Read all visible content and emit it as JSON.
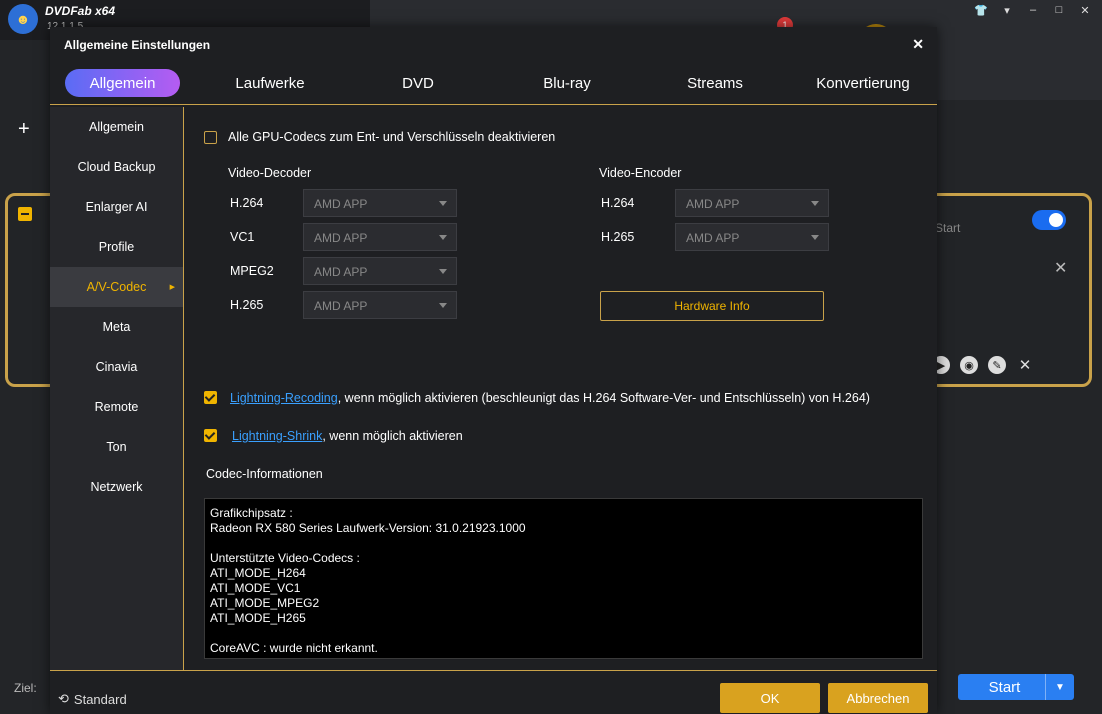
{
  "app": {
    "name": "DVDFab x64",
    "version": "12.1.1.5",
    "notification_count": "1",
    "task_toggle_label": "Start",
    "target_label": "Ziel:",
    "start_button": "Start"
  },
  "dialog": {
    "title": "Allgemeine Einstellungen",
    "tabs": [
      {
        "label": "Allgemein",
        "active": true
      },
      {
        "label": "Laufwerke"
      },
      {
        "label": "DVD"
      },
      {
        "label": "Blu-ray"
      },
      {
        "label": "Streams"
      },
      {
        "label": "Konvertierung"
      }
    ],
    "sidebar": [
      {
        "label": "Allgemein"
      },
      {
        "label": "Cloud Backup"
      },
      {
        "label": "Enlarger AI"
      },
      {
        "label": "Profile"
      },
      {
        "label": "A/V-Codec",
        "active": true
      },
      {
        "label": "Meta"
      },
      {
        "label": "Cinavia"
      },
      {
        "label": "Remote"
      },
      {
        "label": "Ton"
      },
      {
        "label": "Netzwerk"
      }
    ],
    "gpu_disable": {
      "label": "Alle GPU-Codecs zum Ent- und Verschlüsseln deaktivieren",
      "checked": false
    },
    "decoder": {
      "heading": "Video-Decoder",
      "rows": [
        {
          "codec": "H.264",
          "value": "AMD APP"
        },
        {
          "codec": "VC1",
          "value": "AMD APP"
        },
        {
          "codec": "MPEG2",
          "value": "AMD APP"
        },
        {
          "codec": "H.265",
          "value": "AMD APP"
        }
      ]
    },
    "encoder": {
      "heading": "Video-Encoder",
      "rows": [
        {
          "codec": "H.264",
          "value": "AMD APP"
        },
        {
          "codec": "H.265",
          "value": "AMD APP"
        }
      ]
    },
    "hardware_info_button": "Hardware Info",
    "lightning_recoding": {
      "link": "Lightning-Recoding",
      "text": ", wenn möglich aktivieren (beschleunigt das H.264 Software-Ver- und Entschlüsseln) von H.264)",
      "checked": true
    },
    "lightning_shrink": {
      "link": "Lightning-Shrink",
      "text": ", wenn möglich aktivieren",
      "checked": true
    },
    "codec_info": {
      "heading": "Codec-Informationen",
      "lines": [
        "Grafikchipsatz :",
        "Radeon RX 580 Series Laufwerk-Version: 31.0.21923.1000",
        "",
        "Unterstützte Video-Codecs :",
        "ATI_MODE_H264",
        "ATI_MODE_VC1",
        "ATI_MODE_MPEG2",
        "ATI_MODE_H265",
        "",
        "CoreAVC : wurde nicht erkannt."
      ]
    },
    "footer": {
      "standard": "Standard",
      "ok": "OK",
      "cancel": "Abbrechen"
    }
  },
  "colors": {
    "accent_gold": "#f0b400",
    "link_blue": "#3aa0ff",
    "tab_gradient": [
      "#5a6cf5",
      "#b55cf2"
    ],
    "start_blue": "#2a7ff2"
  }
}
